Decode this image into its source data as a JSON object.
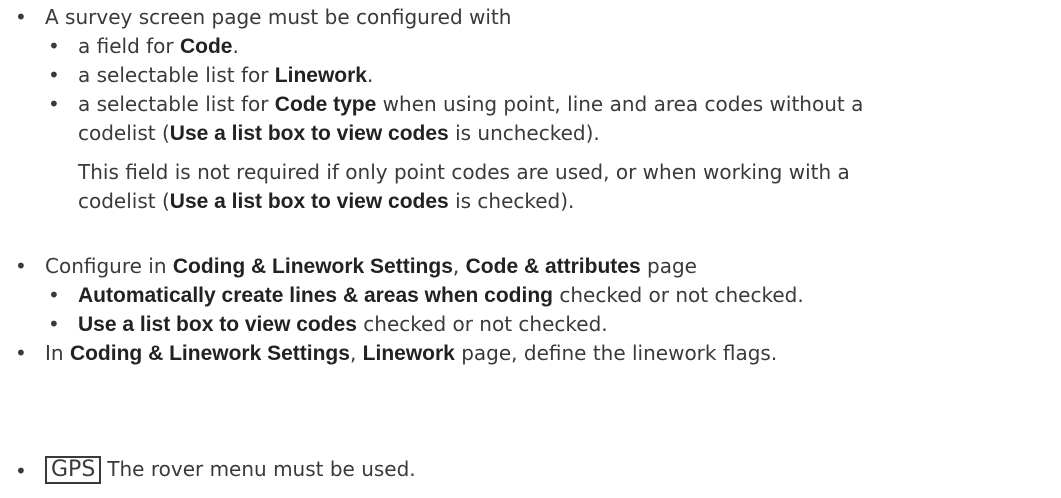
{
  "items": [
    {
      "pre": "A survey screen page must be configured with"
    },
    {
      "pre": "a field for ",
      "b1": "Code",
      "post": "."
    },
    {
      "pre": "a selectable list for ",
      "b1": "Linework",
      "post": "."
    },
    {
      "pre": "a selectable list for ",
      "b1": "Code type",
      "post": " when using point, line and area codes without a"
    },
    {
      "pre": "codelist (",
      "b1": "Use a list box to view codes",
      "post": " is unchecked)."
    },
    {
      "pre": "This field is not required if only point codes are used, or when working with a"
    },
    {
      "pre": "codelist (",
      "b1": "Use a list box to view codes",
      "post": " is checked)."
    },
    {
      "pre": "Configure in ",
      "b1": "Coding & Linework Settings",
      "mid": ", ",
      "b2": "Code & attributes",
      "post": " page"
    },
    {
      "b1": "Automatically create lines & areas when coding",
      "post": " checked or not checked."
    },
    {
      "b1": "Use a list box to view codes",
      "post": " checked or not checked."
    },
    {
      "pre": "In ",
      "b1": "Coding & Linework Settings",
      "mid": ", ",
      "b2": "Linework",
      "post": " page, define the linework flags."
    },
    {
      "key": "GPS",
      "post": "The rover menu must be used."
    }
  ]
}
